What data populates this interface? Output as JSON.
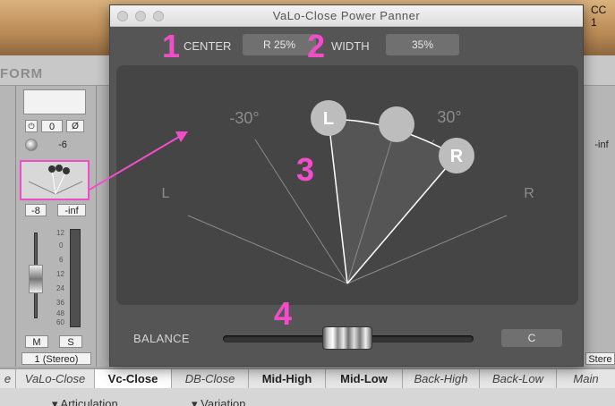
{
  "background": {
    "section_label": "FORM",
    "cc_label": "CC 1",
    "left_strip": {
      "mute_btn": "M",
      "solo_btn": "S",
      "output": "1 (Stereo)",
      "pan_value": "-6",
      "gain_value": "0",
      "vol_a": "-8",
      "vol_b": "-inf"
    },
    "fader_scale": [
      "12",
      "0",
      "6",
      "12",
      "24",
      "36",
      "48",
      "60"
    ],
    "right_strip": {
      "value": "-inf",
      "output": "Stere"
    },
    "tabs": [
      {
        "label": "e",
        "style": "italic"
      },
      {
        "label": "VaLo-Close",
        "style": "italic"
      },
      {
        "label": "Vc-Close",
        "style": "bold selected"
      },
      {
        "label": "DB-Close",
        "style": "italic"
      },
      {
        "label": "Mid-High",
        "style": "bold"
      },
      {
        "label": "Mid-Low",
        "style": "bold"
      },
      {
        "label": "Back-High",
        "style": "italic"
      },
      {
        "label": "Back-Low",
        "style": "italic"
      },
      {
        "label": "Main",
        "style": "italic"
      }
    ],
    "bottom_labels": [
      "Articulation",
      "Variation"
    ]
  },
  "plugin": {
    "title": "VaLo-Close Power Panner",
    "center": {
      "label": "CENTER",
      "value": "R 25%"
    },
    "width": {
      "label": "WIDTH",
      "value": "35%"
    },
    "display": {
      "left_angle": "-30°",
      "right_angle": "30°",
      "left_side": "L",
      "right_side": "R",
      "left_knob": "L",
      "right_knob": "R"
    },
    "balance": {
      "label": "BALANCE",
      "value": "C"
    }
  },
  "annotations": [
    "1",
    "2",
    "3",
    "4"
  ],
  "colors": {
    "annotation": "#f04ec9",
    "panel": "#555555",
    "display": "#454545"
  }
}
